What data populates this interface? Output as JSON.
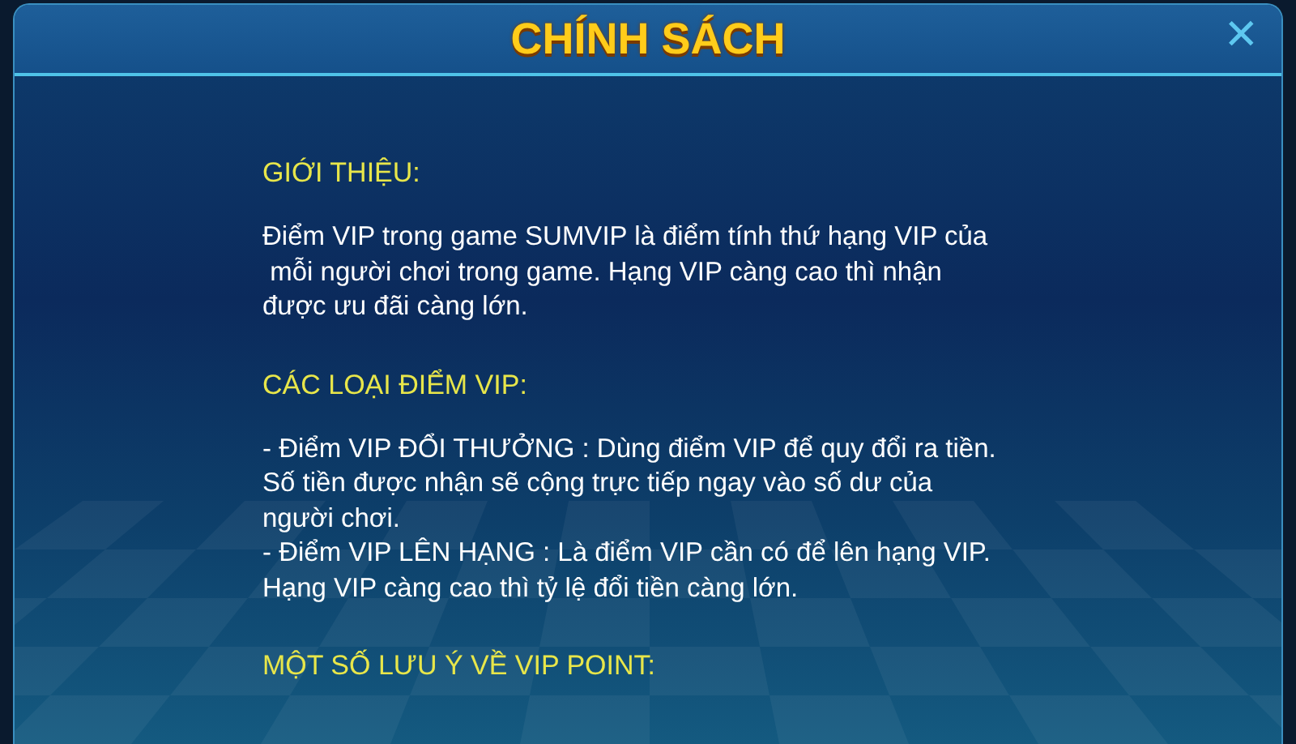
{
  "dialog": {
    "title": "CHÍNH SÁCH",
    "close": "✕"
  },
  "sections": [
    {
      "heading": "GIỚI THIỆU:",
      "paragraphs": [
        "Điểm VIP trong game SUMVIP là điểm tính thứ hạng VIP của\n mỗi người chơi trong game. Hạng VIP càng cao thì nhận\nđược ưu đãi càng lớn."
      ]
    },
    {
      "heading": "CÁC LOẠI ĐIỂM VIP:",
      "paragraphs": [
        "- Điểm VIP ĐỔI THƯỞNG : Dùng điểm VIP để quy đổi ra tiền.\nSố tiền được nhận sẽ cộng trực tiếp ngay vào số dư của\nngười chơi.",
        "- Điểm VIP LÊN HẠNG : Là điểm VIP cần có để lên hạng VIP.\nHạng VIP càng cao thì tỷ lệ đổi tiền càng lớn."
      ]
    },
    {
      "heading": "MỘT SỐ LƯU Ý VỀ VIP POINT:"
    }
  ]
}
